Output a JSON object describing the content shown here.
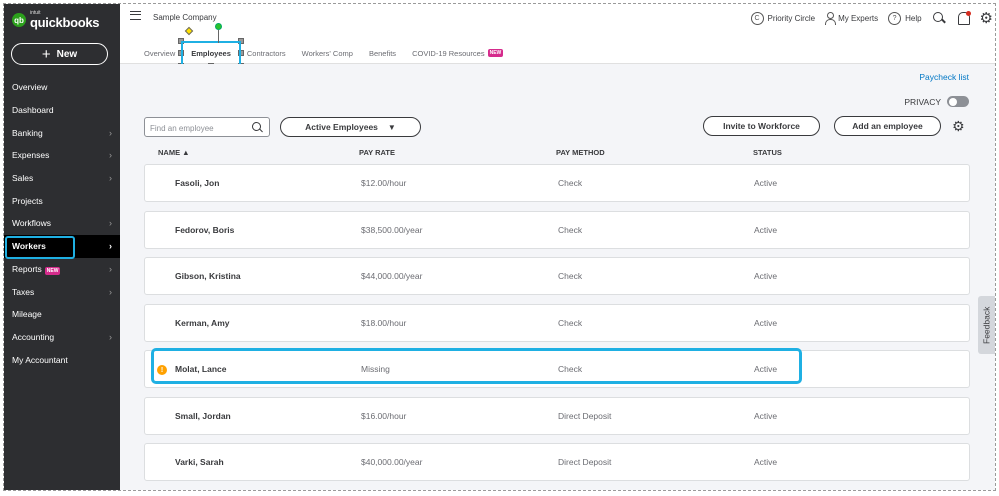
{
  "brand": {
    "intuit": "intuit",
    "name": "quickbooks",
    "mark": "qb"
  },
  "sidebar": {
    "new_label": "New",
    "items": [
      {
        "label": "Overview",
        "chevron": false
      },
      {
        "label": "Dashboard",
        "chevron": false
      },
      {
        "label": "Banking",
        "chevron": true
      },
      {
        "label": "Expenses",
        "chevron": true
      },
      {
        "label": "Sales",
        "chevron": true
      },
      {
        "label": "Projects",
        "chevron": false
      },
      {
        "label": "Workflows",
        "chevron": true
      },
      {
        "label": "Workers",
        "chevron": true,
        "active": true
      },
      {
        "label": "Reports",
        "chevron": true,
        "tag": "NEW"
      },
      {
        "label": "Taxes",
        "chevron": true
      },
      {
        "label": "Mileage",
        "chevron": false
      },
      {
        "label": "Accounting",
        "chevron": true
      },
      {
        "label": "My Accountant",
        "chevron": false
      }
    ]
  },
  "header": {
    "company": "Sample Company",
    "priority_circle": "Priority Circle",
    "my_experts": "My Experts",
    "help": "Help",
    "priority_icon_glyph": "C",
    "help_icon_glyph": "?"
  },
  "tabs": [
    {
      "label": "Overview"
    },
    {
      "label": "Employees",
      "active": true
    },
    {
      "label": "Contractors"
    },
    {
      "label": "Workers' Comp"
    },
    {
      "label": "Benefits"
    },
    {
      "label": "COVID-19 Resources",
      "tag": "NEW"
    }
  ],
  "toolbar": {
    "paycheck_list": "Paycheck list",
    "privacy": "PRIVACY",
    "search_placeholder": "Find an employee",
    "filter_value": "Active Employees",
    "invite": "Invite to Workforce",
    "add_employee": "Add an employee"
  },
  "table": {
    "columns": [
      "NAME ▲",
      "PAY RATE",
      "PAY METHOD",
      "STATUS"
    ],
    "rows": [
      {
        "name": "Fasoli, Jon",
        "rate": "$12.00/hour",
        "method": "Check",
        "status": "Active"
      },
      {
        "name": "Fedorov, Boris",
        "rate": "$38,500.00/year",
        "method": "Check",
        "status": "Active"
      },
      {
        "name": "Gibson, Kristina",
        "rate": "$44,000.00/year",
        "method": "Check",
        "status": "Active"
      },
      {
        "name": "Kerman, Amy",
        "rate": "$18.00/hour",
        "method": "Check",
        "status": "Active"
      },
      {
        "name": "Molat, Lance",
        "rate": "Missing",
        "method": "Check",
        "status": "Active",
        "warning": true
      },
      {
        "name": "Small, Jordan",
        "rate": "$16.00/hour",
        "method": "Direct Deposit",
        "status": "Active"
      },
      {
        "name": "Varki, Sarah",
        "rate": "$40,000.00/year",
        "method": "Direct Deposit",
        "status": "Active"
      }
    ]
  },
  "feedback": "Feedback",
  "colors": {
    "highlight": "#1fb0e3",
    "brand_green": "#2ca01c",
    "sidebar_bg": "#2d2e31",
    "warning": "#ffa100",
    "new_tag": "#d52b8c"
  }
}
